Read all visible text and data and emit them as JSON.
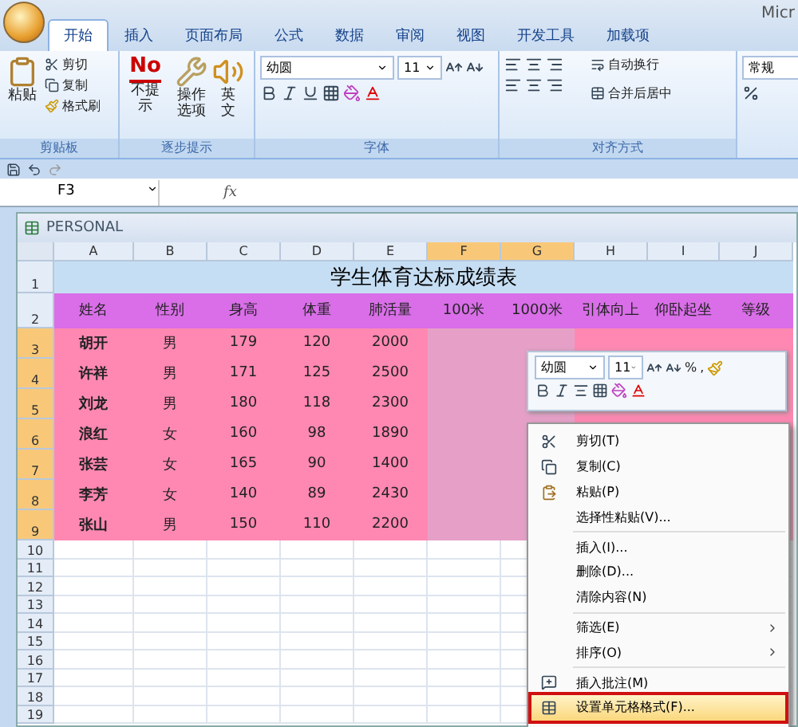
{
  "window": {
    "title": "Micr"
  },
  "ribbon": {
    "tabs": [
      {
        "label": "开始",
        "selected": true
      },
      {
        "label": "插入",
        "selected": false
      },
      {
        "label": "页面布局",
        "selected": false
      },
      {
        "label": "公式",
        "selected": false
      },
      {
        "label": "数据",
        "selected": false
      },
      {
        "label": "审阅",
        "selected": false
      },
      {
        "label": "视图",
        "selected": false
      },
      {
        "label": "开发工具",
        "selected": false
      },
      {
        "label": "加载项",
        "selected": false
      }
    ],
    "clipboard": {
      "label": "剪贴板",
      "paste": "粘贴",
      "items": [
        "剪切",
        "复制",
        "格式刷"
      ]
    },
    "tips": {
      "label": "逐步提示",
      "logo": "No",
      "buttons": [
        "不提示",
        "操作选项",
        "英文"
      ]
    },
    "font": {
      "label": "字体",
      "name": "幼圆",
      "size": "11"
    },
    "alignment": {
      "label": "对齐方式",
      "wrap": "自动换行",
      "merge": "合并后居中"
    },
    "number": {
      "format": "常规"
    }
  },
  "formula_bar": {
    "name_box": "F3",
    "fx": "fx"
  },
  "workbook": {
    "title": "PERSONAL",
    "columns": [
      {
        "label": "A",
        "selected": false
      },
      {
        "label": "B",
        "selected": false
      },
      {
        "label": "C",
        "selected": false
      },
      {
        "label": "D",
        "selected": false
      },
      {
        "label": "E",
        "selected": false
      },
      {
        "label": "F",
        "selected": true
      },
      {
        "label": "G",
        "selected": true
      },
      {
        "label": "H",
        "selected": false
      },
      {
        "label": "I",
        "selected": false
      },
      {
        "label": "J",
        "selected": false
      }
    ],
    "rows": [
      {
        "number": "1",
        "selected": false,
        "kind": "title",
        "cells": [
          "学生体育达标成绩表"
        ]
      },
      {
        "number": "2",
        "selected": false,
        "kind": "header",
        "cells": [
          "姓名",
          "性别",
          "身高",
          "体重",
          "肺活量",
          "100米",
          "1000米",
          "引体向上",
          "仰卧起坐",
          "等级"
        ]
      },
      {
        "number": "3",
        "selected": true,
        "kind": "data",
        "cells": [
          "胡开",
          "男",
          "179",
          "120",
          "2000"
        ]
      },
      {
        "number": "4",
        "selected": true,
        "kind": "data",
        "cells": [
          "许祥",
          "男",
          "171",
          "125",
          "2500"
        ]
      },
      {
        "number": "5",
        "selected": true,
        "kind": "data",
        "cells": [
          "刘龙",
          "男",
          "180",
          "118",
          "2300"
        ]
      },
      {
        "number": "6",
        "selected": true,
        "kind": "data",
        "cells": [
          "浪红",
          "女",
          "160",
          "98",
          "1890"
        ]
      },
      {
        "number": "7",
        "selected": true,
        "kind": "data",
        "cells": [
          "张芸",
          "女",
          "165",
          "90",
          "1400"
        ]
      },
      {
        "number": "8",
        "selected": true,
        "kind": "data",
        "cells": [
          "李芳",
          "女",
          "140",
          "89",
          "2430"
        ]
      },
      {
        "number": "9",
        "selected": true,
        "kind": "data",
        "cells": [
          "张山",
          "男",
          "150",
          "110",
          "2200"
        ]
      },
      {
        "number": "10",
        "selected": false,
        "kind": "empty"
      },
      {
        "number": "11",
        "selected": false,
        "kind": "empty"
      },
      {
        "number": "12",
        "selected": false,
        "kind": "empty"
      },
      {
        "number": "13",
        "selected": false,
        "kind": "empty"
      },
      {
        "number": "14",
        "selected": false,
        "kind": "empty"
      },
      {
        "number": "15",
        "selected": false,
        "kind": "empty"
      },
      {
        "number": "16",
        "selected": false,
        "kind": "empty"
      },
      {
        "number": "17",
        "selected": false,
        "kind": "empty"
      },
      {
        "number": "18",
        "selected": false,
        "kind": "empty"
      },
      {
        "number": "19",
        "selected": false,
        "kind": "empty"
      }
    ]
  },
  "mini_toolbar": {
    "font": "幼圆",
    "size": "11",
    "percent": "%",
    "comma": ","
  },
  "context_menu": {
    "groups": [
      [
        {
          "label": "剪切(T)",
          "kind": "cut",
          "submenu": false,
          "selected": false
        },
        {
          "label": "复制(C)",
          "kind": "copy",
          "submenu": false,
          "selected": false
        },
        {
          "label": "粘贴(P)",
          "kind": "paste",
          "submenu": false,
          "selected": false
        },
        {
          "label": "选择性粘贴(V)...",
          "kind": "plain",
          "submenu": false,
          "selected": false
        }
      ],
      [
        {
          "label": "插入(I)...",
          "kind": "plain",
          "submenu": false,
          "selected": false
        },
        {
          "label": "删除(D)...",
          "kind": "plain",
          "submenu": false,
          "selected": false
        },
        {
          "label": "清除内容(N)",
          "kind": "plain",
          "submenu": false,
          "selected": false
        }
      ],
      [
        {
          "label": "筛选(E)",
          "kind": "plain",
          "submenu": true,
          "selected": false
        },
        {
          "label": "排序(O)",
          "kind": "plain",
          "submenu": true,
          "selected": false
        }
      ],
      [
        {
          "label": "插入批注(M)",
          "kind": "comment",
          "submenu": false,
          "selected": false
        },
        {
          "label": "设置单元格格式(F)...",
          "kind": "format",
          "submenu": false,
          "selected": true
        }
      ]
    ]
  }
}
